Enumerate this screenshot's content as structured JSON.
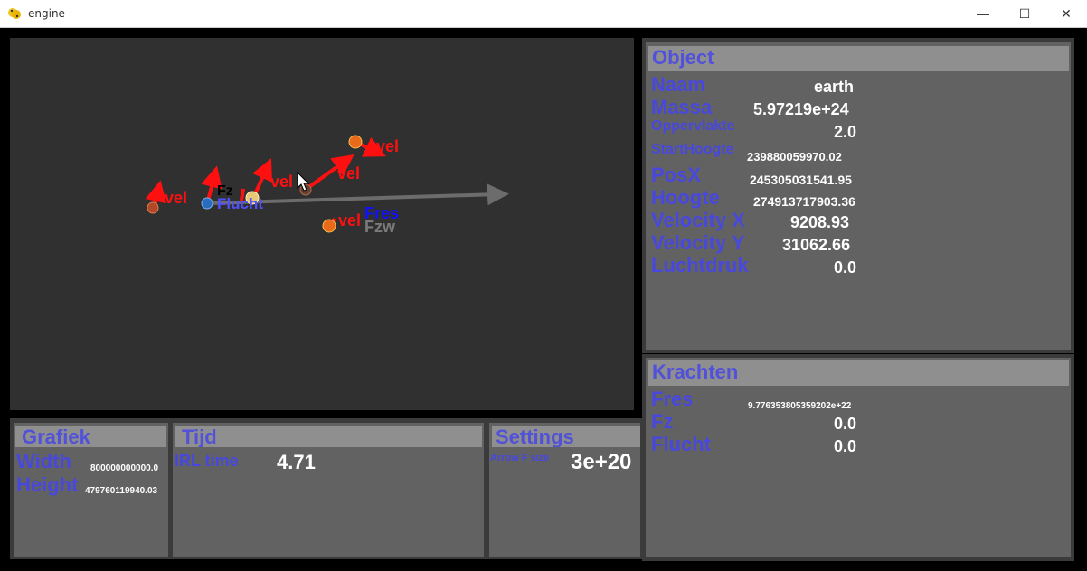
{
  "window": {
    "title": "engine",
    "minimize": "—",
    "maximize": "☐",
    "close": "✕"
  },
  "canvas": {
    "labels": {
      "vel": "vel",
      "fz": "Fz",
      "flucht": "Flucht",
      "fres": "Fres",
      "fzw": "Fzw"
    },
    "colors": {
      "velocity": "#ff1010",
      "gravity_label": "#000000",
      "flucht_label": "#5050ff",
      "fres_label": "#1010ff",
      "fzw_label": "#7a7a7a",
      "path": "#6c6c6c",
      "background": "#303030"
    }
  },
  "object_panel": {
    "title": "Object",
    "rows": [
      {
        "label": "Naam",
        "value": "earth"
      },
      {
        "label": "Massa",
        "value": "5.97219e+24"
      },
      {
        "label": "Oppervlakte",
        "value": "2.0"
      },
      {
        "label": "StartHoogte",
        "value": "239880059970.02"
      },
      {
        "label": "PosX",
        "value": "245305031541.95"
      },
      {
        "label": "Hoogte",
        "value": "274913717903.36"
      },
      {
        "label": "Velocity X",
        "value": "9208.93"
      },
      {
        "label": "Velocity Y",
        "value": "31062.66"
      },
      {
        "label": "Luchtdruk",
        "value": "0.0"
      }
    ]
  },
  "forces_panel": {
    "title": "Krachten",
    "rows": [
      {
        "label": "Fres",
        "value": "9.776353805359202e+22"
      },
      {
        "label": "Fz",
        "value": "0.0"
      },
      {
        "label": "Flucht",
        "value": "0.0"
      }
    ]
  },
  "graph_panel": {
    "title": "Grafiek",
    "rows": [
      {
        "label": "Width",
        "value": "800000000000.0"
      },
      {
        "label": "Height",
        "value": "479760119940.03"
      }
    ]
  },
  "time_panel": {
    "title": "Tijd",
    "irl_label": "IRL time",
    "irl_value": "4.71"
  },
  "settings_panel": {
    "title": "Settings",
    "arrow_label": "Arrow F size",
    "arrow_value": "3e+20"
  },
  "colors": {
    "panel": "#626262",
    "header": "#8f8f8f",
    "label": "#4848df",
    "value": "#ffffff"
  }
}
